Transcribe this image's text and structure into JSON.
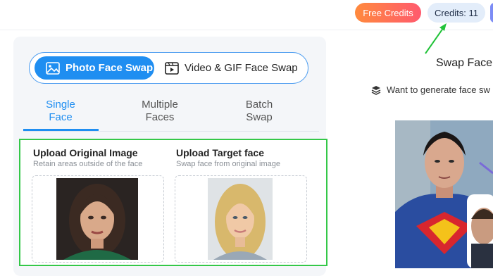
{
  "header": {
    "free_credits_label": "Free Credits",
    "credits_label": "Credits: 11"
  },
  "modes": {
    "photo_label": "Photo Face Swap",
    "video_label": "Video & GIF Face Swap"
  },
  "tabs": [
    {
      "line1": "Single",
      "line2": "Face",
      "active": true
    },
    {
      "line1": "Multiple",
      "line2": "Faces",
      "active": false
    },
    {
      "line1": "Batch",
      "line2": "Swap",
      "active": false
    }
  ],
  "upload": {
    "original_title": "Upload Original Image",
    "original_sub": "Retain areas outside of the face",
    "target_title": "Upload Target face",
    "target_sub": "Swap face from original image"
  },
  "right": {
    "title": "Swap Face",
    "note": "Want to generate face sw"
  },
  "colors": {
    "accent": "#1f8ef1",
    "highlight": "#34c848",
    "free_credits_gradient_start": "#ff8a3d",
    "free_credits_gradient_end": "#ff5a6e"
  }
}
